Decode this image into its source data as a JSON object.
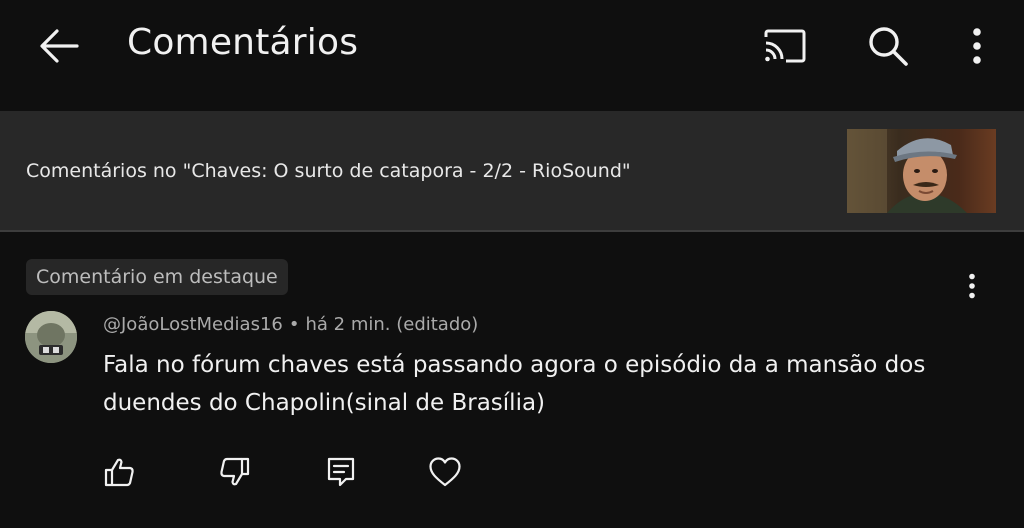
{
  "header": {
    "title": "Comentários",
    "icons": [
      "back-arrow-icon",
      "cast-icon",
      "search-icon",
      "more-vertical-icon"
    ]
  },
  "video": {
    "banner_text": "Comentários no \"Chaves: O surto de catapora - 2/2 - RioSound\""
  },
  "comment": {
    "pinned_label": "Comentário em destaque",
    "author": "@JoãoLostMedias16",
    "separator": "•",
    "time": "há 2 min. (editado)",
    "text": "Fala no fórum chaves está passando agora o episódio da a mansão dos duendes do Chapolin(sinal de Brasília)",
    "actions": [
      "thumb-up-icon",
      "thumb-down-icon",
      "reply-icon",
      "heart-icon"
    ]
  },
  "colors": {
    "background": "#0f0f0f",
    "banner": "#282828",
    "badge": "#272727",
    "text_primary": "#f1f1f1",
    "text_secondary": "#aaaaaa"
  }
}
